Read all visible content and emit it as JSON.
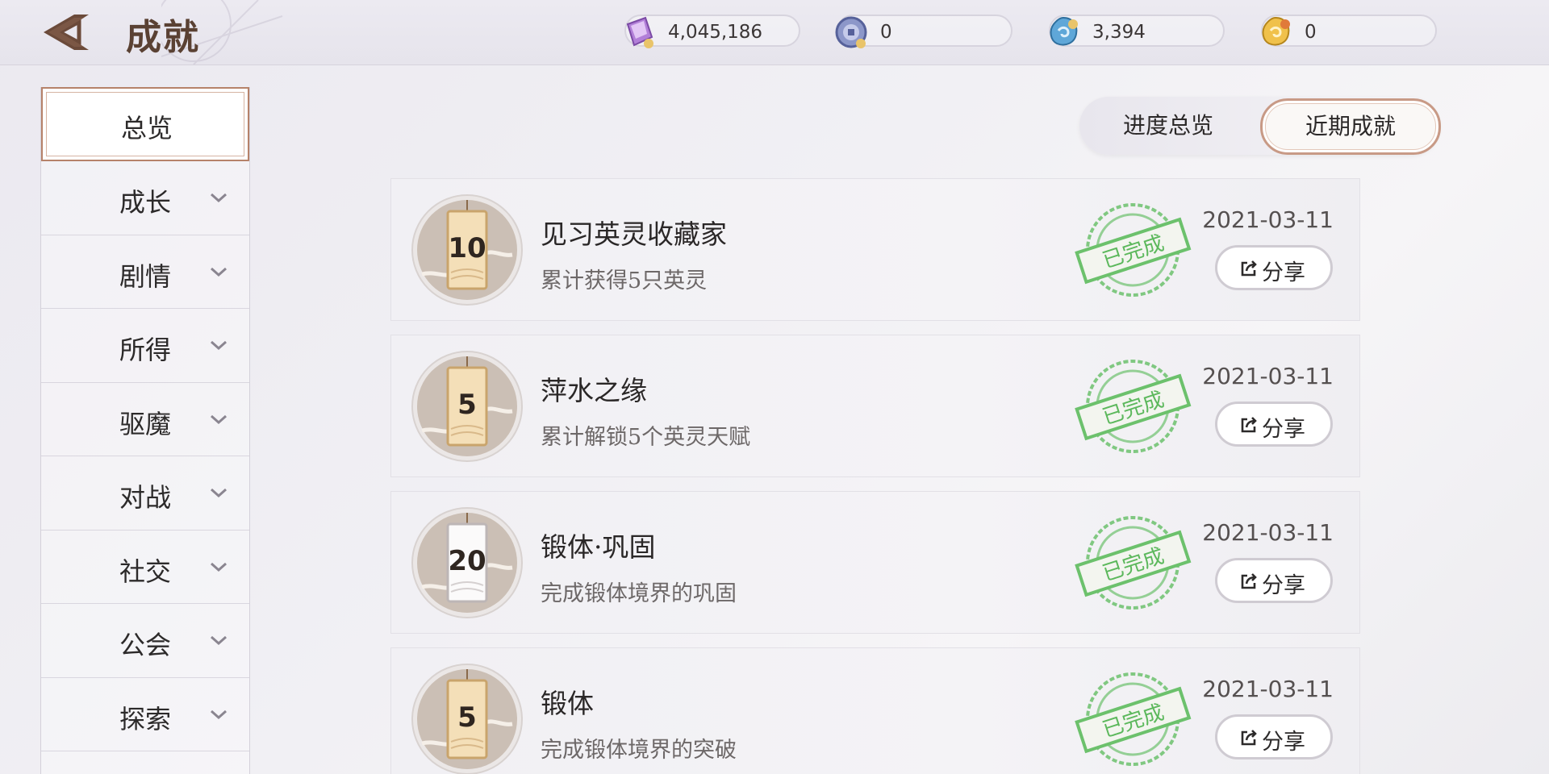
{
  "header": {
    "title": "成就",
    "back_icon": "back-arrow-icon",
    "currencies": [
      {
        "icon": "purple-crystal-icon",
        "value": "4,045,186"
      },
      {
        "icon": "silver-coin-icon",
        "value": "0"
      },
      {
        "icon": "blue-jade-icon",
        "value": "3,394"
      },
      {
        "icon": "gold-ingot-icon",
        "value": "0"
      }
    ]
  },
  "sidebar": {
    "items": [
      {
        "label": "总览",
        "active": true
      },
      {
        "label": "成长"
      },
      {
        "label": "剧情"
      },
      {
        "label": "所得"
      },
      {
        "label": "驱魔"
      },
      {
        "label": "对战"
      },
      {
        "label": "社交"
      },
      {
        "label": "公会"
      },
      {
        "label": "探索"
      }
    ]
  },
  "tabs": {
    "progress_overview": "进度总览",
    "recent_achievements": "近期成就",
    "active": "近期成就"
  },
  "achievements": [
    {
      "points": "10",
      "title": "见习英灵收藏家",
      "desc": "累计获得5只英灵",
      "stamp": "已完成",
      "date": "2021-03-11",
      "share": "分享"
    },
    {
      "points": "5",
      "title": "萍水之缘",
      "desc": "累计解锁5个英灵天赋",
      "stamp": "已完成",
      "date": "2021-03-11",
      "share": "分享"
    },
    {
      "points": "20",
      "title": "锻体·巩固",
      "desc": "完成锻体境界的巩固",
      "stamp": "已完成",
      "date": "2021-03-11",
      "share": "分享"
    },
    {
      "points": "5",
      "title": "锻体",
      "desc": "完成锻体境界的突破",
      "stamp": "已完成",
      "date": "2021-03-11",
      "share": "分享"
    }
  ],
  "colors": {
    "accent_border": "#b6826a",
    "stamp_green": "#5cb85c",
    "title_brown": "#5a4133"
  }
}
